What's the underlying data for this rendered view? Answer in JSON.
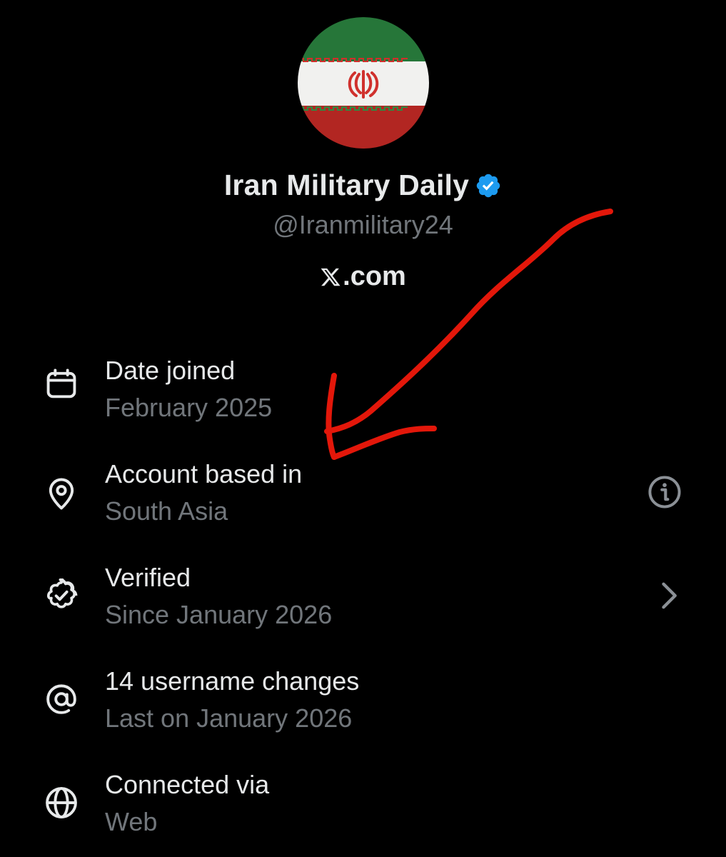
{
  "profile": {
    "display_name": "Iran Military Daily",
    "handle": "@Iranmilitary24",
    "verified": true,
    "badge_color": "#1d9bf0",
    "avatar_icon": "iran-flag-avatar",
    "source_label": ".com",
    "source_logo": "x-logo-icon"
  },
  "about": {
    "rows": [
      {
        "icon": "calendar-icon",
        "title": "Date joined",
        "subtitle": "February 2025"
      },
      {
        "icon": "location-pin-icon",
        "title": "Account based in",
        "subtitle": "South Asia",
        "trailing": "info-icon"
      },
      {
        "icon": "verified-check-icon",
        "title": "Verified",
        "subtitle": "Since January 2026",
        "trailing": "chevron-right-icon"
      },
      {
        "icon": "at-sign-icon",
        "title": "14 username changes",
        "subtitle": "Last on January 2026"
      },
      {
        "icon": "globe-icon",
        "title": "Connected via",
        "subtitle": "Web"
      }
    ]
  },
  "annotation": {
    "color": "#e3170a",
    "shape": "red-arrow"
  }
}
